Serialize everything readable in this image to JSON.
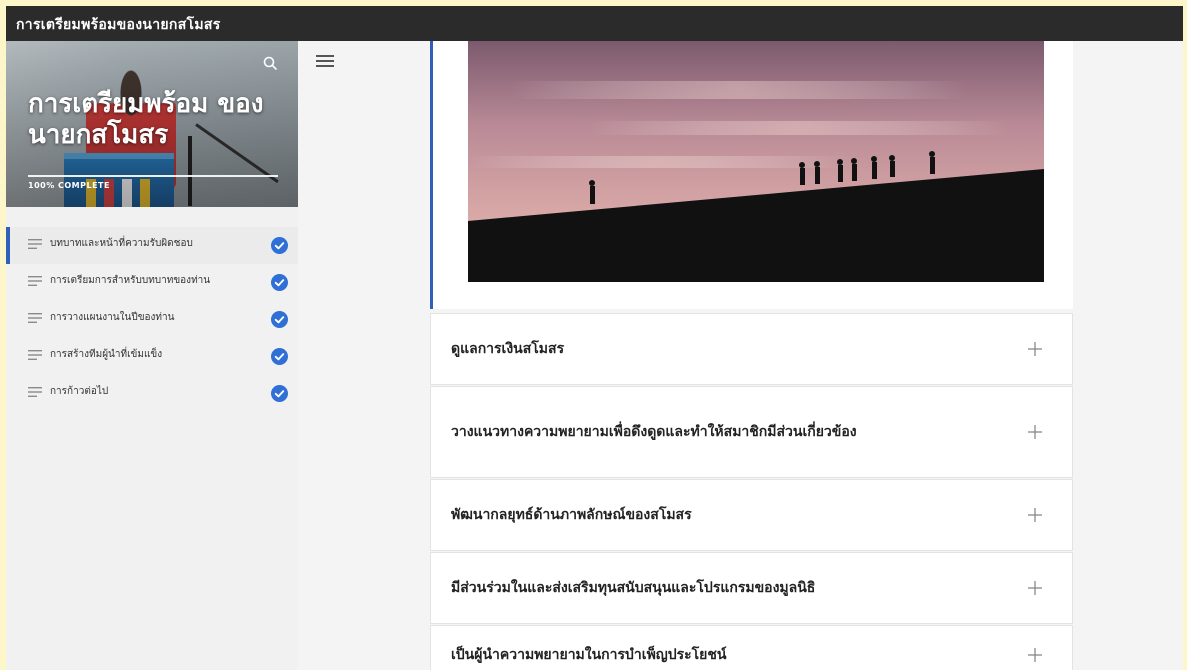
{
  "window_title": "การเตรียมพร้อมของนายกสโมสร",
  "sidebar": {
    "course_title": "การเตรียมพร้อม ของนายกสโมสร",
    "progress_text": "100% COMPLETE",
    "lessons": [
      {
        "label": "บทบาทและหน้าที่ความรับผิดชอบ",
        "completed": true,
        "active": true
      },
      {
        "label": "การเตรียมการสำหรับบทบาทของท่าน",
        "completed": true,
        "active": false
      },
      {
        "label": "การวางแผนงานในปีของท่าน",
        "completed": true,
        "active": false
      },
      {
        "label": "การสร้างทีมผู้นำที่เข้มแข็ง",
        "completed": true,
        "active": false
      },
      {
        "label": "การก้าวต่อไป",
        "completed": true,
        "active": false
      }
    ]
  },
  "accordion": [
    {
      "label": "ดูแลการเงินสโมสร"
    },
    {
      "label": "วางแนวทางความพยายามเพื่อดึงดูดและทำให้สมาชิกมีส่วนเกี่ยวข้อง"
    },
    {
      "label": "พัฒนากลยุทธ์ด้านภาพลักษณ์ของสโมสร"
    },
    {
      "label": "มีส่วนร่วมในและส่งเสริมทุนสนับสนุนและโปรแกรมของมูลนิธิ"
    },
    {
      "label": "เป็นผู้นำความพยายามในการบำเพ็ญประโยชน์"
    }
  ],
  "colors": {
    "accent": "#2f5fb8",
    "check": "#2f6fd6",
    "topbar": "#2b2b2b",
    "outer_background": "#fdf6c9"
  }
}
